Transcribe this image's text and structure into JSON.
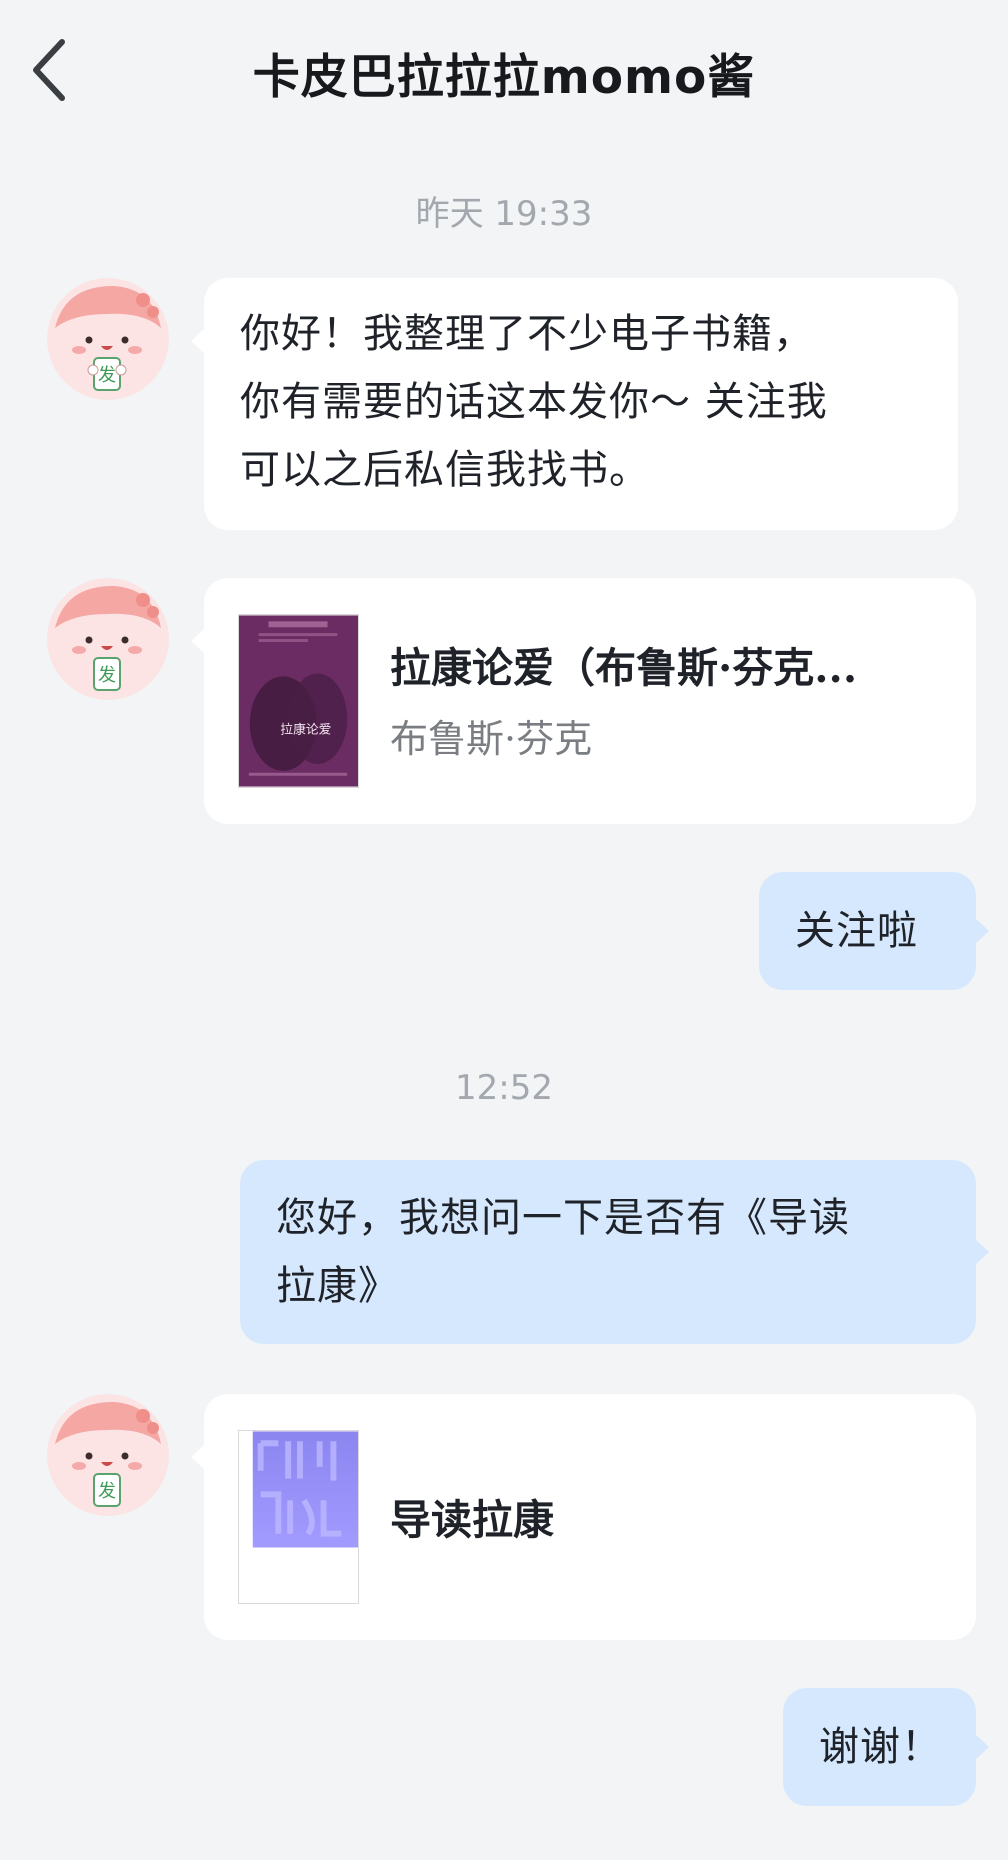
{
  "header": {
    "title": "卡皮巴拉拉拉momo酱"
  },
  "messages": {
    "time1": "昨天 19:33",
    "msg1": {
      "line1": "你好！我整理了不少电子书籍，",
      "line2": "你有需要的话这本发你～ 关注我",
      "line3": "可以之后私信我找书。"
    },
    "book1": {
      "title": "拉康论爱（布鲁斯·芬克...",
      "author": "布鲁斯·芬克",
      "cover_text": "拉康论爱"
    },
    "msg2": "关注啦",
    "time2": "12:52",
    "msg3": {
      "line1": "您好，我想问一下是否有《导读",
      "line2": "拉康》"
    },
    "book2": {
      "title": "导读拉康"
    },
    "msg4": "谢谢！"
  },
  "colors": {
    "background": "#f2f4f6",
    "incoming_bubble": "#ffffff",
    "outgoing_bubble": "#d6e8fd",
    "timestamp": "#a3a8ae"
  },
  "icons": {
    "back": "chevron-left-icon",
    "avatar": "pink-mascot-avatar"
  }
}
